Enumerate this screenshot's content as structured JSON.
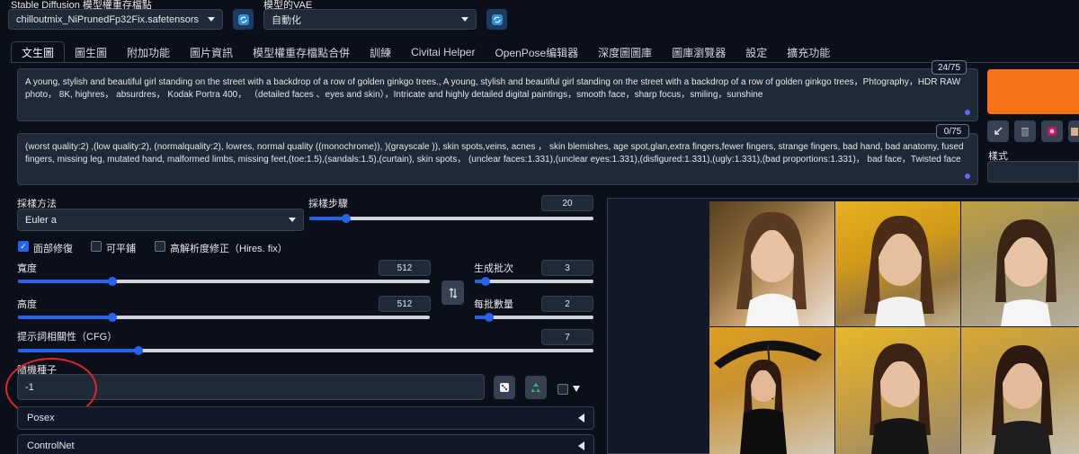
{
  "header": {
    "model_label": "Stable Diffusion 模型權重存檔點",
    "model_value": "chilloutmix_NiPrunedFp32Fix.safetensors",
    "vae_label": "模型的VAE",
    "vae_value": "自動化"
  },
  "tabs": [
    "文生圖",
    "圖生圖",
    "附加功能",
    "圖片資訊",
    "模型權重存檔點合併",
    "訓練",
    "Civitai Helper",
    "OpenPose编辑器",
    "深度圖圖庫",
    "圖庫瀏覽器",
    "設定",
    "擴充功能"
  ],
  "prompt": {
    "positive": "A young, stylish and beautiful girl standing on the street with a backdrop of a row of golden ginkgo trees., A young, stylish and beautiful girl standing on the street with a backdrop of a row of golden ginkgo trees，Phtography，HDR RAW photo， 8K, highres， absurdres， Kodak Portra 400， （detailed faces 、eyes and skin），Intricate and highly detailed digital paintings，smooth face，sharp focus，smiling，sunshine",
    "positive_counter": "24/75",
    "negative": "(worst quality:2) ,(low quality:2), (normalquality:2), lowres, normal quality ((monochrome)), )(grayscale )), skin spots,veins, acnes ， skin blemishes, age spot,glan,extra fingers,fewer fingers, strange fingers, bad hand, bad anatomy, fused fingers, missing leg, mutated hand, malformed limbs, missing feet,(toe:1.5),(sandals:1.5),(curtain), skin spots， (unclear faces:1.331),(unclear eyes:1.331),(disfigured:1.331),(ugly:1.331),(bad proportions:1.331)， bad face，Twisted face",
    "negative_counter": "0/75",
    "styles_label": "樣式"
  },
  "settings": {
    "sampler_label": "採樣方法",
    "sampler_value": "Euler a",
    "steps_label": "採樣步驟",
    "steps_value": "20",
    "steps_fraction": 0.13,
    "restore_faces": "面部修復",
    "tiling": "可平鋪",
    "hires_fix": "高解析度修正（Hires. fix）",
    "width_label": "寬度",
    "width_value": "512",
    "width_fraction": 0.23,
    "height_label": "高度",
    "height_value": "512",
    "height_fraction": 0.23,
    "batch_count_label": "生成批次",
    "batch_count_value": "3",
    "batch_count_fraction": 0.09,
    "batch_size_label": "每批數量",
    "batch_size_value": "2",
    "batch_size_fraction": 0.12,
    "cfg_label": "提示詞相關性（CFG）",
    "cfg_value": "7",
    "cfg_fraction": 0.21,
    "seed_label": "隨機種子",
    "seed_value": "-1",
    "posex_label": "Posex",
    "controlnet_label": "ControlNet"
  },
  "icons": {
    "refresh": "refresh-icon",
    "swap": "swap-icon",
    "dice": "dice-icon",
    "recycle": "recycle-icon",
    "arrow": "arrow-icon",
    "trash": "trash-icon",
    "style": "style-icon",
    "clipboard": "clipboard-icon"
  },
  "colors": {
    "background": "#0b0f19",
    "accent": "#2563eb",
    "generate": "#f97316",
    "seed_circle": "#dc2626"
  }
}
